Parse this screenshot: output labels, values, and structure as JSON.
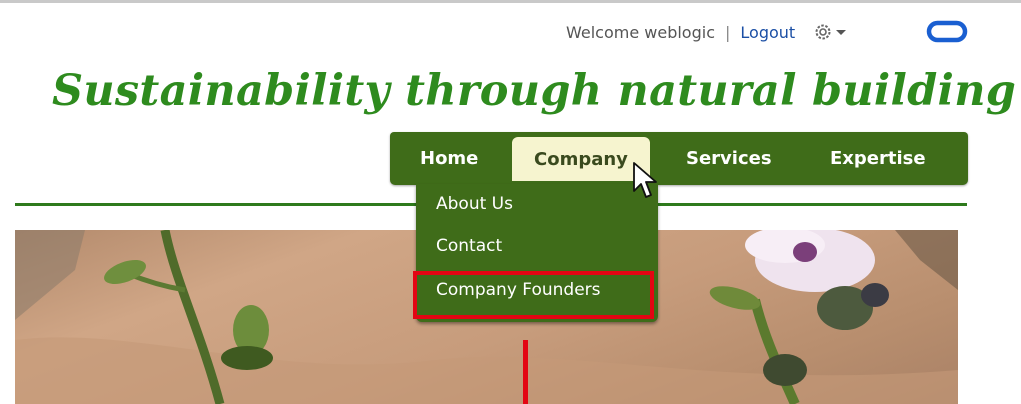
{
  "header": {
    "welcome_text": "Welcome weblogic",
    "separator": "|",
    "logout_label": "Logout"
  },
  "site": {
    "title": "Sustainability through natural building"
  },
  "nav": {
    "items": [
      {
        "label": "Home"
      },
      {
        "label": "Company",
        "active": true
      },
      {
        "label": "Services"
      },
      {
        "label": "Expertise"
      }
    ]
  },
  "dropdown": {
    "items": [
      {
        "label": "About Us"
      },
      {
        "label": "Contact"
      },
      {
        "label": "Company Founders",
        "highlighted": true
      }
    ]
  },
  "icons": {
    "settings": "gear-icon",
    "settings_menu": "chevron-down-icon",
    "brand": "oracle-logo",
    "pointer": "mouse-cursor"
  },
  "colors": {
    "title_green": "#2e8b1e",
    "nav_green": "#3f6c19",
    "active_tab_bg": "#f6f4cf",
    "highlight_red": "#e30613",
    "logout_link": "#1b4fa5"
  }
}
